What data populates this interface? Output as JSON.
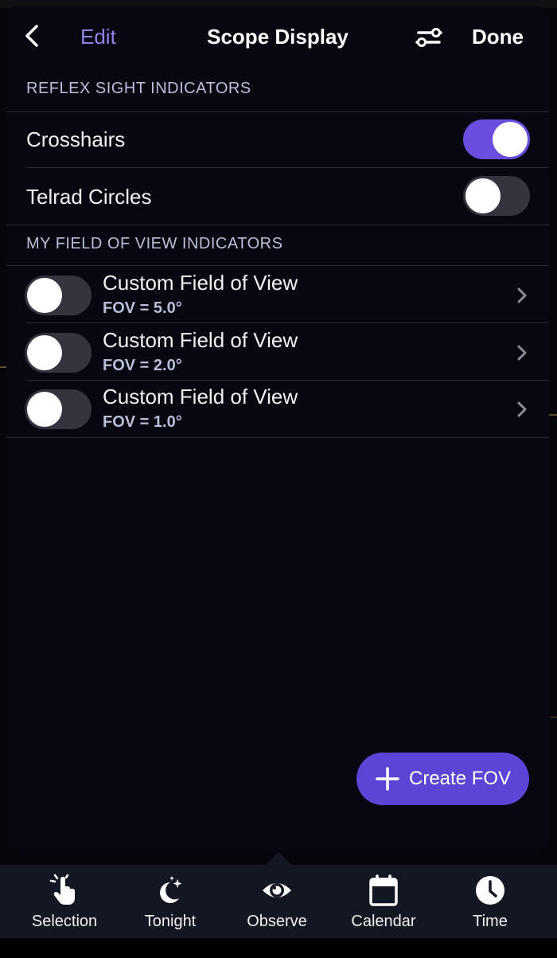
{
  "header": {
    "edit_label": "Edit",
    "title": "Scope Display",
    "done_label": "Done",
    "accent": "#8f83ee"
  },
  "reflex_section": {
    "heading": "REFLEX SIGHT INDICATORS",
    "items": [
      {
        "label": "Crosshairs",
        "on": true
      },
      {
        "label": "Telrad Circles",
        "on": false
      }
    ]
  },
  "fov_section": {
    "heading": "MY FIELD OF VIEW INDICATORS",
    "items": [
      {
        "title": "Custom Field of View",
        "subtitle": "FOV = 5.0°",
        "on": false
      },
      {
        "title": "Custom Field of View",
        "subtitle": "FOV = 2.0°",
        "on": false
      },
      {
        "title": "Custom Field of View",
        "subtitle": "FOV = 1.0°",
        "on": false
      }
    ]
  },
  "create_button": {
    "label": "Create FOV",
    "color": "#5b44d6"
  },
  "tabbar": {
    "tabs": [
      {
        "label": "Selection",
        "icon": "hand-pointer-icon"
      },
      {
        "label": "Tonight",
        "icon": "moon-stars-icon"
      },
      {
        "label": "Observe",
        "icon": "eye-icon"
      },
      {
        "label": "Calendar",
        "icon": "calendar-icon"
      },
      {
        "label": "Time",
        "icon": "clock-icon"
      }
    ],
    "selected": "Observe"
  },
  "toggle_on_color": "#6b4ee0"
}
